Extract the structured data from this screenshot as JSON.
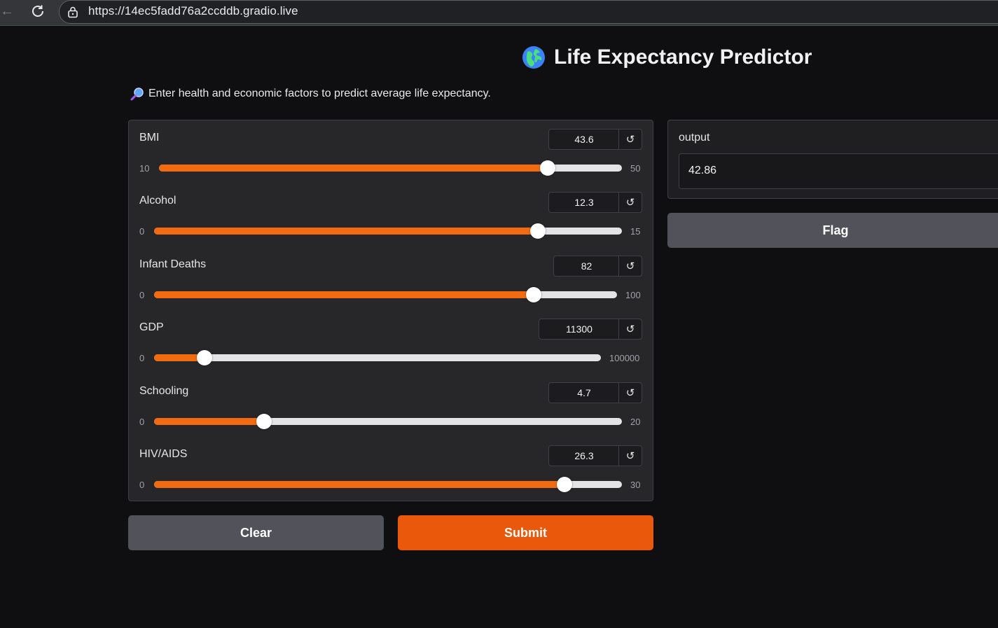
{
  "browser": {
    "url": "https://14ec5fadd76a2ccddb.gradio.live"
  },
  "app": {
    "title": "Life Expectancy Predictor",
    "description": "Enter health and economic factors to predict average life expectancy.",
    "title_icon": "globe-icon",
    "description_icon": "magnifier-icon"
  },
  "sliders": [
    {
      "label": "BMI",
      "value": "43.6",
      "min": "10",
      "max": "50"
    },
    {
      "label": "Alcohol",
      "value": "12.3",
      "min": "0",
      "max": "15"
    },
    {
      "label": "Infant Deaths",
      "value": "82",
      "min": "0",
      "max": "100"
    },
    {
      "label": "GDP",
      "value": "11300",
      "min": "0",
      "max": "100000"
    },
    {
      "label": "Schooling",
      "value": "4.7",
      "min": "0",
      "max": "20"
    },
    {
      "label": "HIV/AIDS",
      "value": "26.3",
      "min": "0",
      "max": "30"
    }
  ],
  "buttons": {
    "clear": "Clear",
    "submit": "Submit",
    "flag": "Flag"
  },
  "output": {
    "label": "output",
    "value": "42.86"
  },
  "colors": {
    "accent": "#f26b10",
    "submit": "#ea580c",
    "secondary_button": "#52525b",
    "background": "#0f0f11"
  }
}
